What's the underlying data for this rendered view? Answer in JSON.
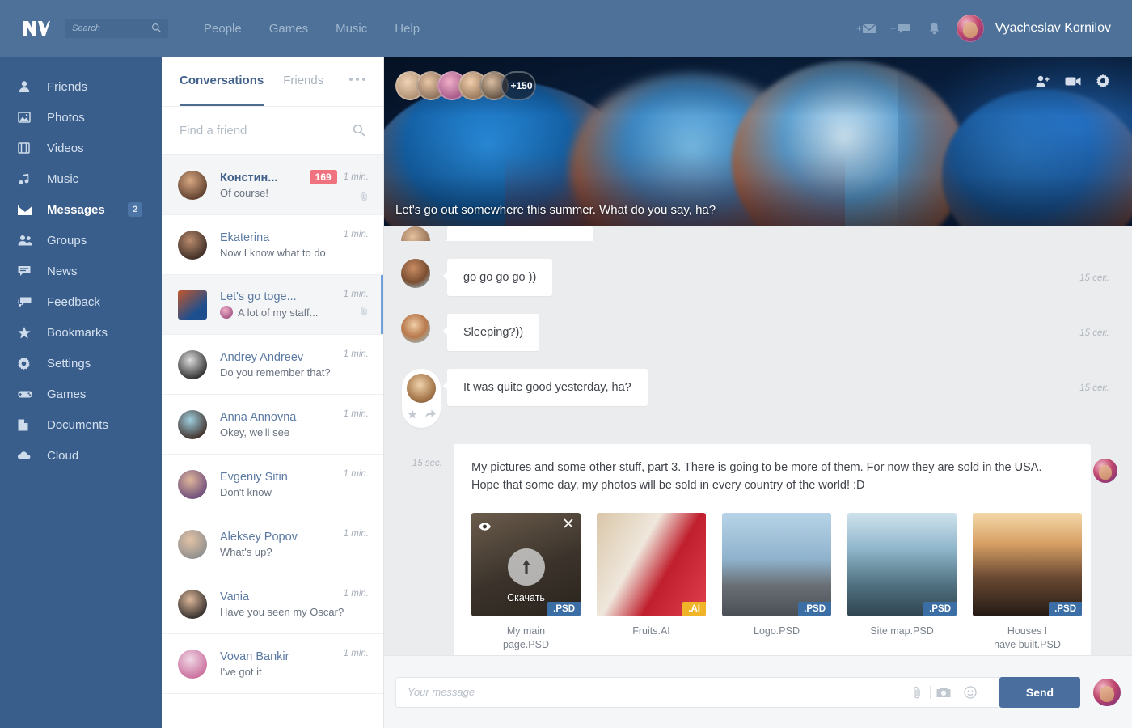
{
  "topbar": {
    "logo": "VK",
    "search_placeholder": "Search",
    "search_value": "",
    "nav": [
      {
        "label": "People"
      },
      {
        "label": "Games"
      },
      {
        "label": "Music"
      },
      {
        "label": "Help"
      }
    ],
    "icons": [
      "new-message-icon",
      "new-post-icon",
      "notifications-bell-icon"
    ],
    "user_name": "Vyacheslav Kornilov"
  },
  "sidebar": {
    "items": [
      {
        "label": "Friends",
        "icon": "person-icon",
        "active": false,
        "badge": ""
      },
      {
        "label": "Photos",
        "icon": "photo-icon",
        "active": false,
        "badge": ""
      },
      {
        "label": "Videos",
        "icon": "film-icon",
        "active": false,
        "badge": ""
      },
      {
        "label": "Music",
        "icon": "note-icon",
        "active": false,
        "badge": ""
      },
      {
        "label": "Messages",
        "icon": "envelope-icon",
        "active": true,
        "badge": "2"
      },
      {
        "label": "Groups",
        "icon": "people-icon",
        "active": false,
        "badge": ""
      },
      {
        "label": "News",
        "icon": "news-icon",
        "active": false,
        "badge": ""
      },
      {
        "label": "Feedback",
        "icon": "comments-icon",
        "active": false,
        "badge": ""
      },
      {
        "label": "Bookmarks",
        "icon": "star-icon",
        "active": false,
        "badge": ""
      },
      {
        "label": "Settings",
        "icon": "gear-icon",
        "active": false,
        "badge": ""
      },
      {
        "label": "Games",
        "icon": "gamepad-icon",
        "active": false,
        "badge": ""
      },
      {
        "label": "Documents",
        "icon": "document-icon",
        "active": false,
        "badge": ""
      },
      {
        "label": "Cloud",
        "icon": "cloud-icon",
        "active": false,
        "badge": ""
      }
    ]
  },
  "conversations": {
    "tabs": [
      {
        "label": "Conversations",
        "active": true
      },
      {
        "label": "Friends",
        "active": false
      }
    ],
    "more_label": "more-options",
    "search_placeholder": "Find a friend",
    "search_value": "",
    "items": [
      {
        "name": "Констин...",
        "preview": "Of course!",
        "time": "1 min.",
        "badge": "169",
        "clip": true,
        "unread": true,
        "selected": false,
        "bold": true,
        "square": false,
        "mini": false,
        "avatar": "will-smith",
        "c1": "#5a3b2b",
        "c2": "#d8a882"
      },
      {
        "name": "Ekaterina",
        "preview": "Now I know what to do",
        "time": "1 min.",
        "badge": "",
        "clip": false,
        "unread": false,
        "selected": false,
        "bold": false,
        "square": false,
        "mini": false,
        "avatar": "woman-1",
        "c1": "#3a2a24",
        "c2": "#b98b6d"
      },
      {
        "name": "Let's go toge...",
        "preview": "A lot of my staff...",
        "time": "1 min.",
        "badge": "",
        "clip": true,
        "unread": false,
        "selected": true,
        "bold": false,
        "square": true,
        "mini": true,
        "avatar": "jellyfish",
        "c1": "#1d4f8f",
        "c2": "#c2572c"
      },
      {
        "name": "Andrey Andreev",
        "preview": "Do you remember that?",
        "time": "1 min.",
        "badge": "",
        "clip": false,
        "unread": false,
        "selected": false,
        "bold": false,
        "square": false,
        "mini": false,
        "avatar": "man-bw",
        "c1": "#2a2a2a",
        "c2": "#dddddd"
      },
      {
        "name": "Anna Annovna",
        "preview": "Okey, we'll see",
        "time": "1 min.",
        "badge": "",
        "clip": false,
        "unread": false,
        "selected": false,
        "bold": false,
        "square": false,
        "mini": false,
        "avatar": "woman-2",
        "c1": "#3e2c25",
        "c2": "#9fd0e0"
      },
      {
        "name": "Evgeniy Sitin",
        "preview": "Don't know",
        "time": "1 min.",
        "badge": "",
        "clip": false,
        "unread": false,
        "selected": false,
        "bold": false,
        "square": false,
        "mini": false,
        "avatar": "man-purple",
        "c1": "#6a4a7a",
        "c2": "#e0b79a"
      },
      {
        "name": "Aleksey Popov",
        "preview": "What's up?",
        "time": "1 min.",
        "badge": "",
        "clip": false,
        "unread": false,
        "selected": false,
        "bold": false,
        "square": false,
        "mini": false,
        "avatar": "man-gray",
        "c1": "#8d8d8d",
        "c2": "#e3c3a6"
      },
      {
        "name": "Vania",
        "preview": "Have you seen my Oscar?",
        "time": "1 min.",
        "badge": "",
        "clip": false,
        "unread": false,
        "selected": false,
        "bold": false,
        "square": false,
        "mini": false,
        "avatar": "man-beard",
        "c1": "#2e2a28",
        "c2": "#dcb79a"
      },
      {
        "name": "Vovan Bankir",
        "preview": "I've got it",
        "time": "1 min.",
        "badge": "",
        "clip": false,
        "unread": false,
        "selected": false,
        "bold": false,
        "square": false,
        "mini": false,
        "avatar": "man-pink",
        "c1": "#c96b9b",
        "c2": "#efd7e4"
      }
    ]
  },
  "chat_header": {
    "caption": "Let's go out somewhere this summer. What do you say, ha?",
    "participants_overflow": "+150",
    "participant_count": 5,
    "icons": [
      "add-person-icon",
      "video-call-icon",
      "gear-icon"
    ]
  },
  "messages": [
    {
      "text": "",
      "time": "",
      "author": "partial",
      "kind": "partial"
    },
    {
      "text": "go go go go ))",
      "time": "15 сек.",
      "author": "dark-woman",
      "kind": "bubble"
    },
    {
      "text": "Sleeping?))",
      "time": "15 сек.",
      "author": "asian-woman",
      "kind": "bubble"
    },
    {
      "text": "It was quite good yesterday, ha?",
      "time": "15 сек.",
      "author": "nicolas-cage",
      "kind": "bubble-highlight",
      "actions": [
        "star-icon",
        "forward-icon"
      ]
    }
  ],
  "attachment_message": {
    "time": "15 sec.",
    "text": "My pictures and some other stuff, part 3. There is going to be more of them. For now they are sold in the USA. Hope that some day, my photos will be sold in every country of the world! :D",
    "files": [
      {
        "label": "My main\npage.PSD",
        "ext": ".PSD",
        "ext_type": "psd",
        "overlay": true,
        "overlay_label": "Скачать",
        "thumb": "bear"
      },
      {
        "label": "Fruits.AI",
        "ext": ".AI",
        "ext_type": "ai",
        "overlay": false,
        "overlay_label": "",
        "thumb": "raspberries"
      },
      {
        "label": "Logo.PSD",
        "ext": ".PSD",
        "ext_type": "psd",
        "overlay": false,
        "overlay_label": "",
        "thumb": "city"
      },
      {
        "label": "Site map.PSD",
        "ext": ".PSD",
        "ext_type": "psd",
        "overlay": false,
        "overlay_label": "",
        "thumb": "mountains"
      },
      {
        "label": "Houses I\nhave built.PSD",
        "ext": ".PSD",
        "ext_type": "psd",
        "overlay": false,
        "overlay_label": "",
        "thumb": "sunset-hill"
      }
    ]
  },
  "composer": {
    "placeholder": "Your message",
    "value": "",
    "icons": [
      "attach-clip-icon",
      "camera-icon",
      "emoji-icon"
    ],
    "send_label": "Send"
  },
  "colors": {
    "topbar": "#4d7199",
    "sidebar": "#3a5e8c",
    "accent": "#4a6f9e",
    "badge_red": "#f0727f",
    "psd_blue": "#3a6ea5",
    "ai_yellow": "#f0b429",
    "chat_bg": "#ebecee"
  }
}
